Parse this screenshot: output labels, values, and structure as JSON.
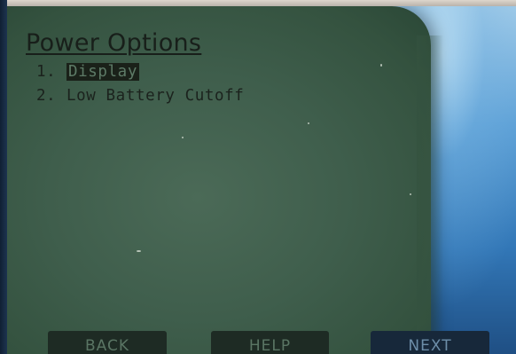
{
  "screen": {
    "title": "Power Options"
  },
  "menu": {
    "items": [
      {
        "number": "1.",
        "label": "Display",
        "selected": true
      },
      {
        "number": "2.",
        "label": "Low Battery Cutoff",
        "selected": false
      }
    ]
  },
  "softkeys": {
    "back": "BACK",
    "help": "HELP",
    "next": "NEXT"
  },
  "colors": {
    "lcd_background": "#3f5e4c",
    "lcd_text": "#1b221d",
    "selection_highlight": "#1a2119"
  }
}
